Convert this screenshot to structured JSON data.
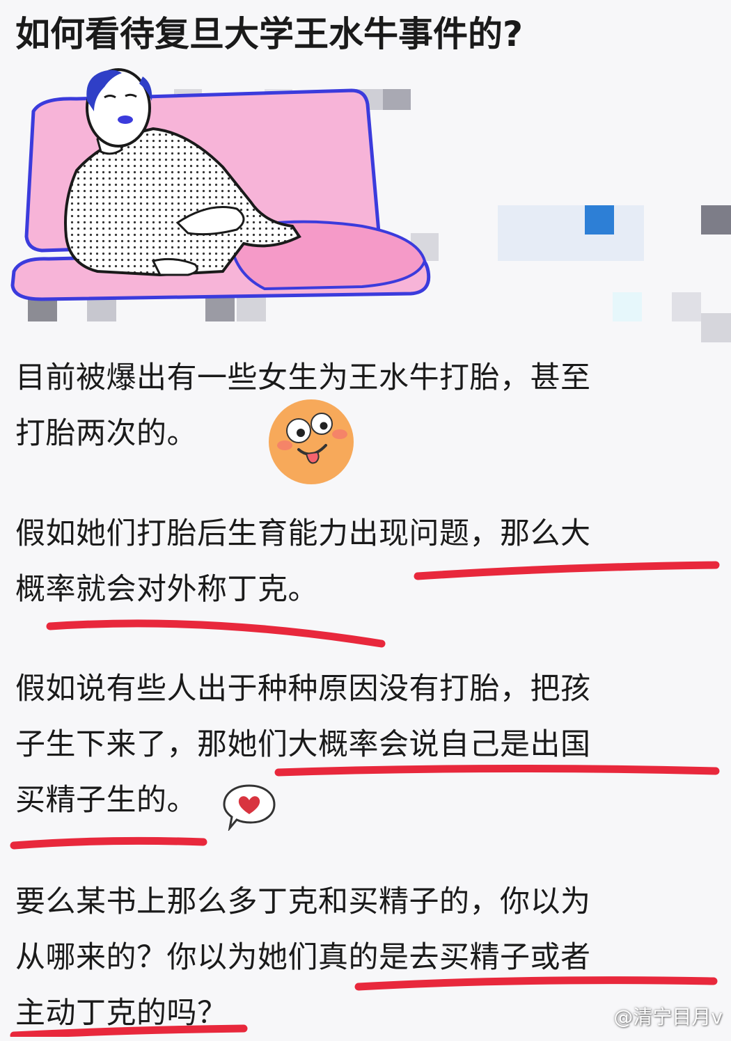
{
  "question_title": "如何看待复旦大学王水牛事件的?",
  "paragraphs": [
    {
      "lines": [
        "目前被爆出有一些女生为王水牛打胎，甚至",
        "打胎两次的。"
      ]
    },
    {
      "lines": [
        "假如她们打胎后生育能力出现问题，那么大",
        "概率就会对外称丁克。"
      ]
    },
    {
      "lines": [
        "假如说有些人出于种种原因没有打胎，把孩",
        "子生下来了，那她们大概率会说自己是出国",
        "买精子生的。"
      ]
    },
    {
      "lines": [
        "要么某书上那么多丁克和买精子的，你以为",
        "从哪来的？你以为她们真的是去买精子或者",
        "主动丁克的吗？"
      ]
    }
  ],
  "emojis": {
    "face": "tongue-out-face-icon",
    "heart": "heart-speech-bubble-icon"
  },
  "watermark": "@清宁目月v",
  "colors": {
    "underline": "#e8283c",
    "sofa": "#f7b4d8",
    "outline": "#3b3bdc",
    "emoji_face": "#f7a95a",
    "heart": "#d8343f"
  }
}
